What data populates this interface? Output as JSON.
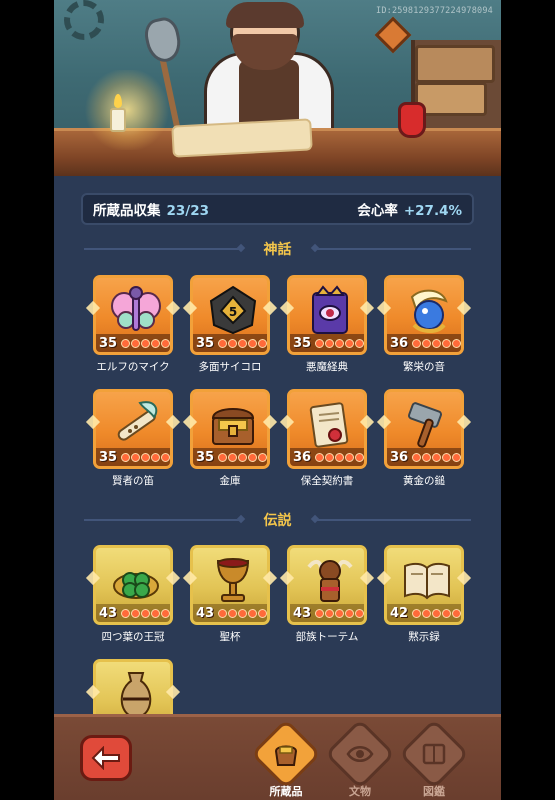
{
  "header": {
    "id_text": "ID:2598129377224978094"
  },
  "stats": {
    "collection_label": "所蔵品収集",
    "collection_value": "23/23",
    "crit_label": "会心率",
    "crit_value": "+27.4%"
  },
  "sections": [
    {
      "title": "神話",
      "items": [
        {
          "name": "エルフのマイク",
          "level": "35",
          "icon": "butterfly-mic-icon"
        },
        {
          "name": "多面サイコロ",
          "level": "35",
          "icon": "dice-icon"
        },
        {
          "name": "悪魔経典",
          "level": "35",
          "icon": "demon-book-icon"
        },
        {
          "name": "繁栄の音",
          "level": "36",
          "icon": "bird-orb-icon"
        },
        {
          "name": "賢者の笛",
          "level": "35",
          "icon": "flute-icon"
        },
        {
          "name": "金庫",
          "level": "35",
          "icon": "treasure-chest-icon"
        },
        {
          "name": "保全契約書",
          "level": "36",
          "icon": "contract-scroll-icon"
        },
        {
          "name": "黄金の鎚",
          "level": "36",
          "icon": "hammer-icon"
        }
      ]
    },
    {
      "title": "伝説",
      "items": [
        {
          "name": "四つ葉の王冠",
          "level": "43",
          "icon": "clover-crown-icon"
        },
        {
          "name": "聖杯",
          "level": "43",
          "icon": "chalice-icon"
        },
        {
          "name": "部族トーテム",
          "level": "43",
          "icon": "totem-icon"
        },
        {
          "name": "黙示録",
          "level": "42",
          "icon": "open-book-icon"
        },
        {
          "name": "",
          "level": "",
          "icon": "vase-icon"
        }
      ]
    }
  ],
  "nav": {
    "back_icon": "back-arrow-icon",
    "tabs": [
      {
        "label": "所蔵品",
        "icon": "treasure-pot-icon",
        "active": true
      },
      {
        "label": "文物",
        "icon": "eye-relic-icon",
        "active": false
      },
      {
        "label": "図鑑",
        "icon": "encyclopedia-icon",
        "active": false
      }
    ]
  },
  "colors": {
    "section_title": "#f4c64b",
    "mythic_card": "#ef8a2a",
    "legend_card": "#e2c455",
    "stat_value": "#9fd7f2"
  }
}
